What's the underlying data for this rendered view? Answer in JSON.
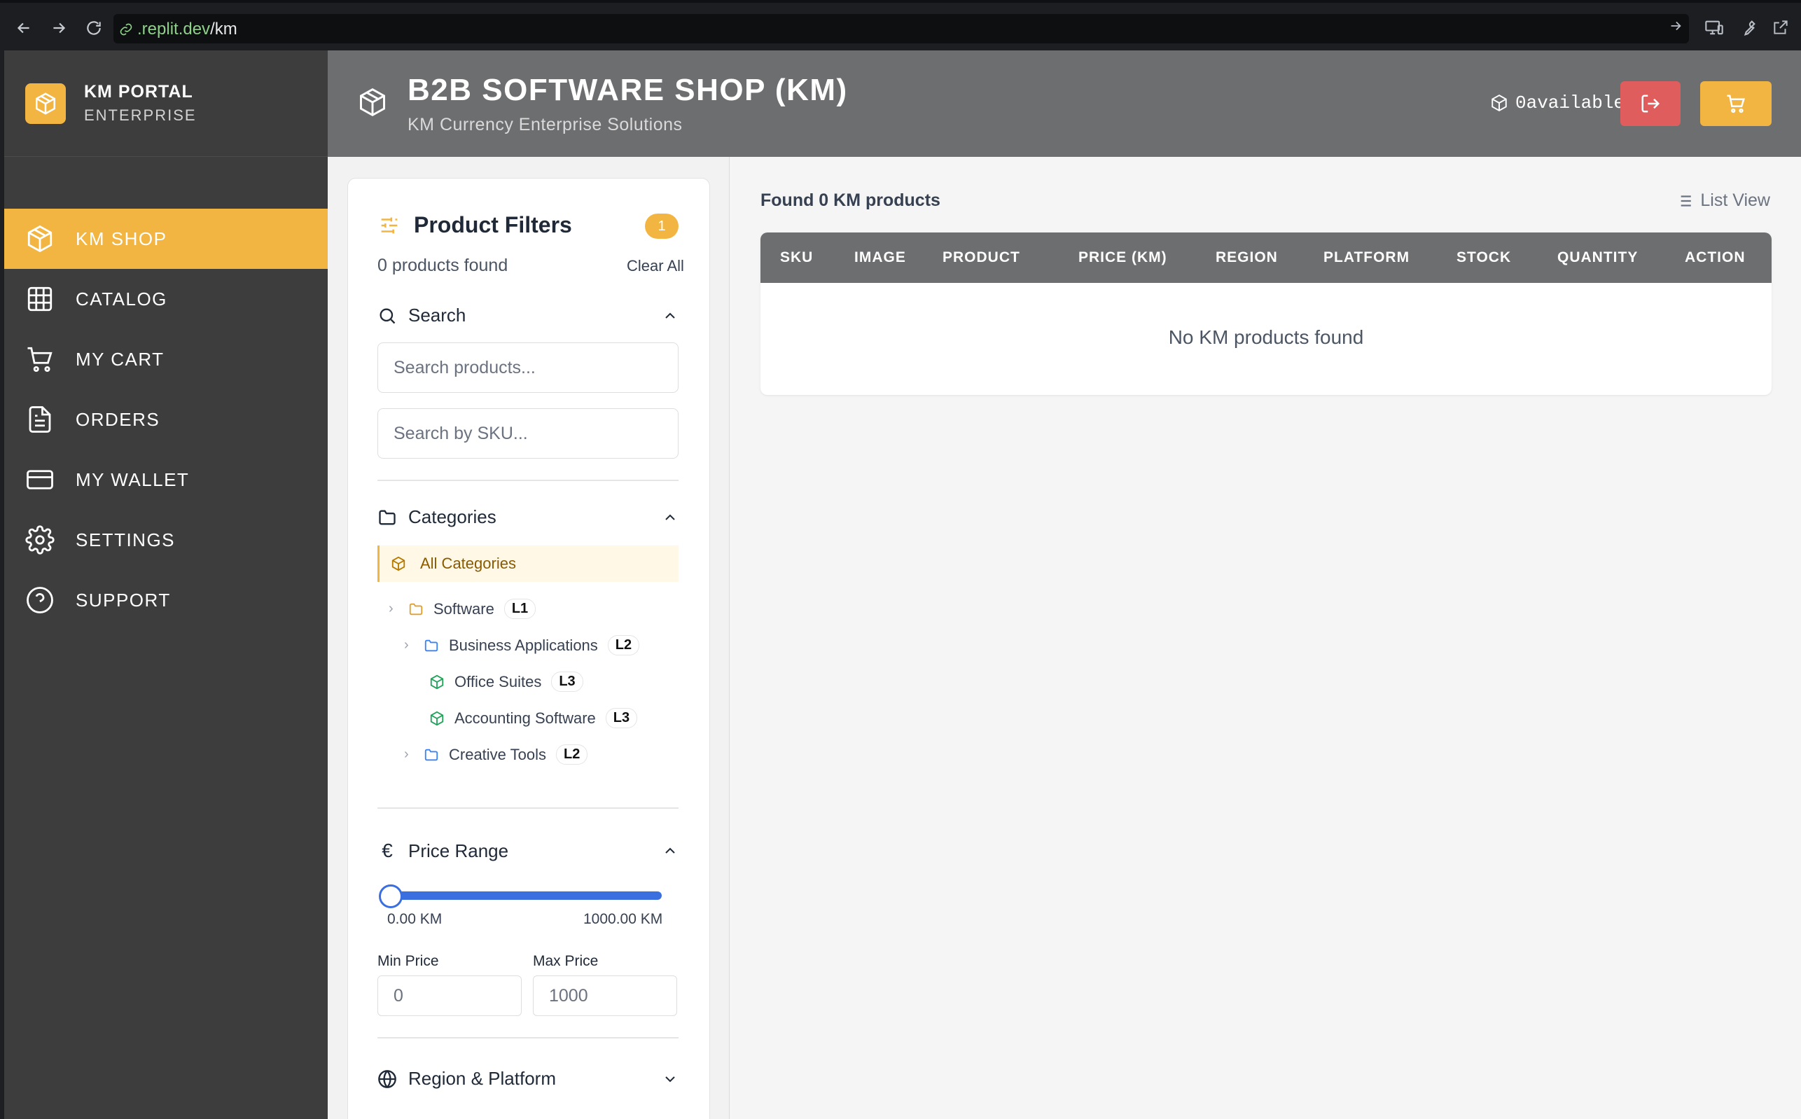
{
  "browser": {
    "url_domain": ".replit.dev",
    "url_path": "/km"
  },
  "sidebar": {
    "brand_title": "KM PORTAL",
    "brand_sub": "ENTERPRISE",
    "items": [
      {
        "label": "KM SHOP",
        "icon": "package-icon",
        "active": true
      },
      {
        "label": "CATALOG",
        "icon": "grid-icon"
      },
      {
        "label": "MY CART",
        "icon": "cart-icon"
      },
      {
        "label": "ORDERS",
        "icon": "document-icon"
      },
      {
        "label": "MY WALLET",
        "icon": "credit-card-icon"
      },
      {
        "label": "SETTINGS",
        "icon": "gear-icon"
      },
      {
        "label": "SUPPORT",
        "icon": "help-circle-icon"
      }
    ]
  },
  "header": {
    "title": "B2B SOFTWARE SHOP (KM)",
    "subtitle": "KM Currency Enterprise Solutions",
    "available": "0available"
  },
  "filters": {
    "title": "Product Filters",
    "badge": "1",
    "count": "0 products found",
    "clear_all": "Clear All",
    "search": {
      "title": "Search",
      "product_placeholder": "Search products...",
      "sku_placeholder": "Search by SKU..."
    },
    "categories": {
      "title": "Categories",
      "all": "All Categories",
      "tree": [
        {
          "label": "Software",
          "level": "L1"
        },
        {
          "label": "Business Applications",
          "level": "L2"
        },
        {
          "label": "Office Suites",
          "level": "L3"
        },
        {
          "label": "Accounting Software",
          "level": "L3"
        },
        {
          "label": "Creative Tools",
          "level": "L2"
        }
      ]
    },
    "price": {
      "title": "Price Range",
      "min_label": "0.00 KM",
      "max_label": "1000.00 KM",
      "min_price_label": "Min Price",
      "max_price_label": "Max Price",
      "min_value": "0",
      "max_value": "1000"
    },
    "region": {
      "title": "Region & Platform"
    }
  },
  "main": {
    "found": "Found 0 KM products",
    "list_view": "List View",
    "columns": [
      "SKU",
      "IMAGE",
      "PRODUCT",
      "PRICE (KM)",
      "REGION",
      "PLATFORM",
      "STOCK",
      "QUANTITY",
      "ACTION"
    ],
    "empty": "No KM products found"
  },
  "colors": {
    "accent": "#f3b542",
    "danger": "#e05d5d",
    "sidebar": "#3d3d3d",
    "header": "#6d6e70",
    "slider": "#3b6fe0"
  }
}
